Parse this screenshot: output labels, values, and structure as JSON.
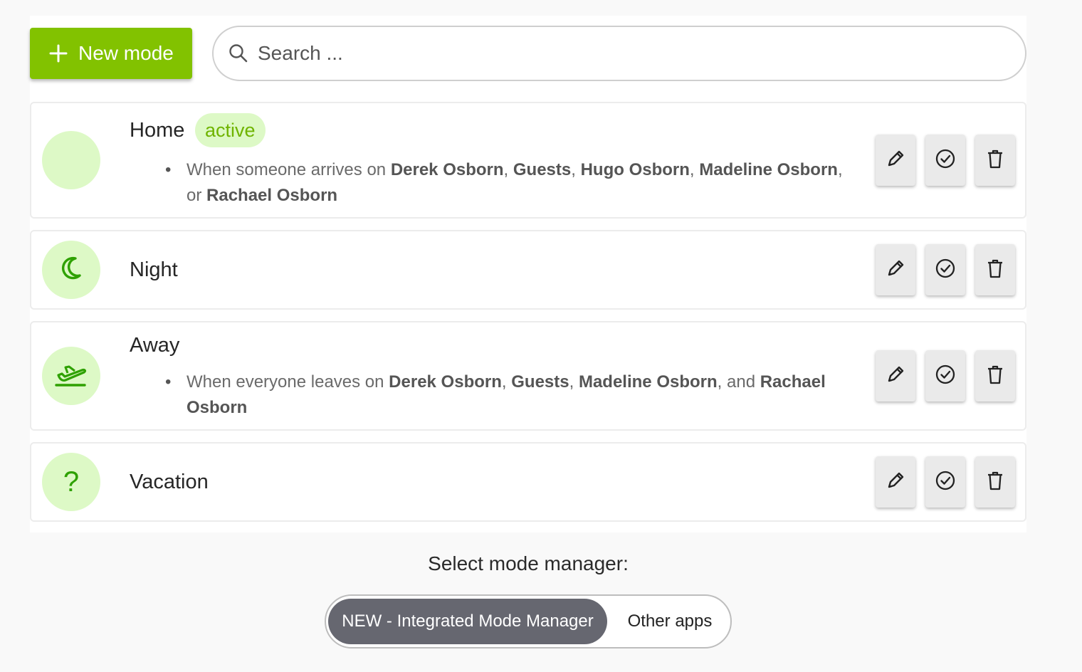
{
  "toolbar": {
    "new_mode_label": "New mode",
    "search_placeholder": "Search ..."
  },
  "modes": [
    {
      "name": "Home",
      "icon": "blank",
      "badge": "active",
      "rule": {
        "prefix": "When someone arrives on",
        "people": [
          "Derek Osborn",
          "Guests",
          "Hugo Osborn",
          "Madeline Osborn",
          "Rachael Osborn"
        ],
        "sep1": ", ",
        "sep2": ", ",
        "sep3": ", ",
        "sep4": ",",
        "conj": "or"
      }
    },
    {
      "name": "Night",
      "icon": "moon-icon"
    },
    {
      "name": "Away",
      "icon": "airplane-takeoff-icon",
      "rule": {
        "prefix": "When everyone leaves on",
        "people": [
          "Derek Osborn",
          "Guests",
          "Madeline Osborn",
          "Rachael Osborn"
        ],
        "sep1": ", ",
        "sep2": ", ",
        "sep3": ", ",
        "conj": "and"
      }
    },
    {
      "name": "Vacation",
      "icon": "question-mark-icon",
      "icon_text": "?"
    }
  ],
  "actions": [
    "edit-icon",
    "check-circle-icon",
    "trash-icon"
  ],
  "manager": {
    "label": "Select mode manager:",
    "options": [
      "NEW - Integrated Mode Manager",
      "Other apps"
    ],
    "selected": "NEW - Integrated Mode Manager"
  },
  "colors": {
    "accent": "#82c200",
    "avatar_bg": "#ddf9c6",
    "icon_green": "#2ea100",
    "selected_toggle": "#666770"
  }
}
